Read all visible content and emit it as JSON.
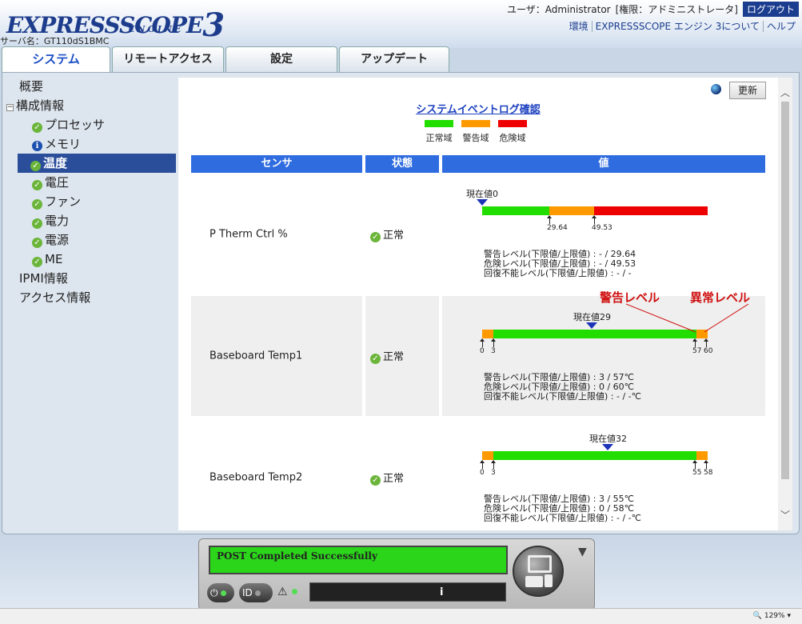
{
  "header": {
    "logo_main": "EXPRESSSCOPE",
    "logo_num": "3",
    "logo_engine": "ENGINE",
    "user": "ユーザ：Administrator",
    "role": "[権限：アドミニストレータ]",
    "logout": "ログアウト",
    "links": [
      "環境",
      "EXPRESSSCOPE エンジン 3について",
      "ヘルプ"
    ],
    "server": "サーバ名：GT110dS1BMC"
  },
  "tabs": [
    "システム",
    "リモートアクセス",
    "設定",
    "アップデート"
  ],
  "nav": {
    "overview": "概要",
    "config": "構成情報",
    "processor": "プロセッサ",
    "memory": "メモリ",
    "temperature": "温度",
    "voltage": "電圧",
    "fan": "ファン",
    "power": "電力",
    "psu": "電源",
    "me": "ME",
    "ipmi": "IPMI情報",
    "access": "アクセス情報"
  },
  "main": {
    "refresh": "更新",
    "event_link": "システムイベントログ確認",
    "legend": [
      {
        "label": "正常域",
        "color": "#22dd00"
      },
      {
        "label": "警告域",
        "color": "#ff9900"
      },
      {
        "label": "危険域",
        "color": "#ee0000"
      }
    ],
    "columns": [
      "センサ",
      "状態",
      "値"
    ],
    "annotation_warning": "警告レベル",
    "annotation_critical": "異常レベル",
    "sensors": [
      {
        "name": "P Therm Ctrl %",
        "status": "正常",
        "current": "現在値0",
        "tick_a": "29.64",
        "tick_b": "49.53",
        "warn": "警告レベル(下限値/上限値) : - / 29.64",
        "crit": "危険レベル(下限値/上限値) : - / 49.53",
        "nonrec": "回復不能レベル(下限値/上限値) : - / -"
      },
      {
        "name": "Baseboard Temp1",
        "status": "正常",
        "current": "現在値29",
        "tick_a": "0",
        "tick_b": "3",
        "tick_c": "57",
        "tick_d": "60",
        "warn": "警告レベル(下限値/上限値) : 3 / 57℃",
        "crit": "危険レベル(下限値/上限値) : 0 / 60℃",
        "nonrec": "回復不能レベル(下限値/上限値) : - / -℃"
      },
      {
        "name": "Baseboard Temp2",
        "status": "正常",
        "current": "現在値32",
        "tick_a": "0",
        "tick_b": "3",
        "tick_c": "55",
        "tick_d": "58",
        "warn": "警告レベル(下限値/上限値) : 3 / 55℃",
        "crit": "危険レベル(下限値/上限値) : 0 / 58℃",
        "nonrec": "回復不能レベル(下限値/上限値) : - / -℃"
      }
    ]
  },
  "panel": {
    "lcd": "POST Completed Successfully",
    "id_label": "ID"
  },
  "statusbar": {
    "zoom": "129%"
  }
}
